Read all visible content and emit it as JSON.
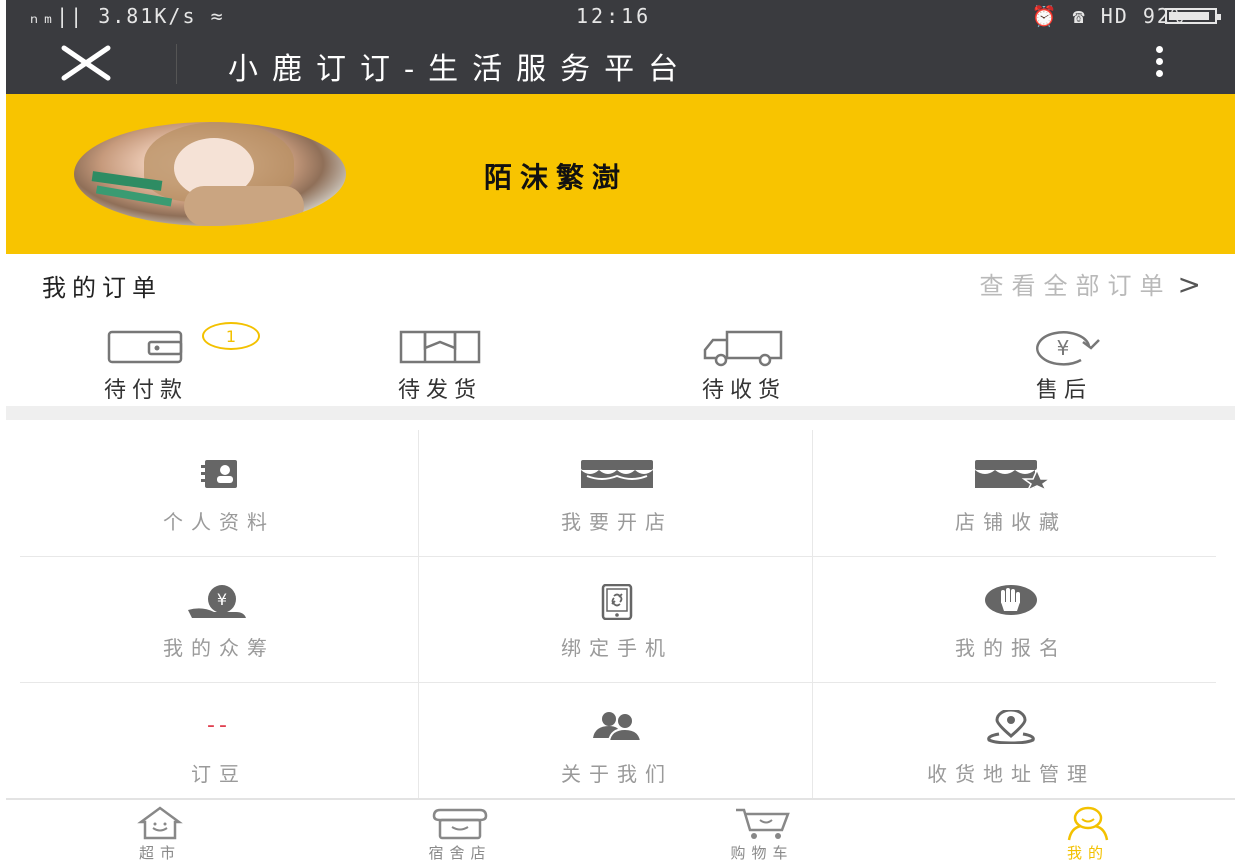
{
  "status_bar": {
    "left": "ₙₘ|| 3.81K/s ≈",
    "time": "12:16",
    "right": "⏰ ☎ HD 92%",
    "battery_level": 0.92
  },
  "title_bar": {
    "title": "小鹿订订-生活服务平台",
    "close_icon": "close-icon",
    "more_icon": "more-vertical-icon"
  },
  "profile": {
    "nickname": "陌沫繁澍",
    "avatar": "avatar-photo"
  },
  "orders": {
    "title": "我的订单",
    "view_all": "查看全部订单",
    "chevron": ">",
    "statuses": [
      {
        "label": "待付款",
        "icon": "wallet-icon",
        "badge": "1"
      },
      {
        "label": "待发货",
        "icon": "package-icon"
      },
      {
        "label": "待收货",
        "icon": "truck-icon"
      },
      {
        "label": "售后",
        "icon": "refund-yen-icon",
        "icon_text": "¥"
      }
    ]
  },
  "features": [
    {
      "label": "个人资料",
      "icon": "profile-card-icon"
    },
    {
      "label": "我要开店",
      "icon": "shop-icon"
    },
    {
      "label": "店铺收藏",
      "icon": "shop-star-icon"
    },
    {
      "label": "我的众筹",
      "icon": "crowdfund-yen-icon",
      "icon_text": "¥"
    },
    {
      "label": "绑定手机",
      "icon": "phone-link-icon"
    },
    {
      "label": "我的报名",
      "icon": "hand-icon"
    },
    {
      "label": "订豆",
      "icon": "dash-icon",
      "icon_text": "--"
    },
    {
      "label": "关于我们",
      "icon": "users-icon"
    },
    {
      "label": "收货地址管理",
      "icon": "location-pin-icon"
    }
  ],
  "bottom_nav": [
    {
      "label": "超市",
      "icon": "home-icon"
    },
    {
      "label": "宿舍店",
      "icon": "store-icon"
    },
    {
      "label": "购物车",
      "icon": "cart-icon"
    },
    {
      "label": "我的",
      "icon": "user-icon",
      "active": true
    }
  ],
  "colors": {
    "header_dark": "#3a3b3f",
    "brand_yellow": "#f8c400",
    "icon_gray": "#777777",
    "muted_text": "#9a9a9a"
  }
}
